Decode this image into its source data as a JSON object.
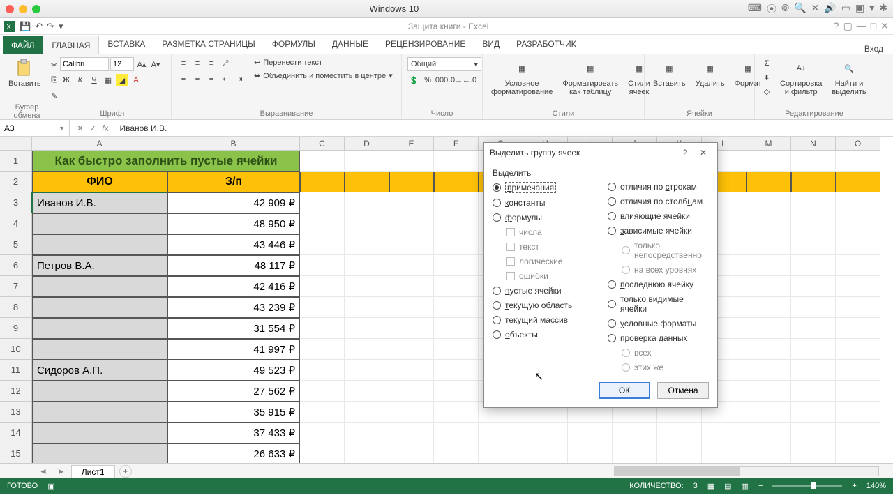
{
  "mac": {
    "title": "Windows 10"
  },
  "qat": {
    "title": "Защита книги - Excel",
    "help_hint": "?"
  },
  "tabs": {
    "file": "ФАЙЛ",
    "items": [
      "ГЛАВНАЯ",
      "ВСТАВКА",
      "РАЗМЕТКА СТРАНИЦЫ",
      "ФОРМУЛЫ",
      "ДАННЫЕ",
      "РЕЦЕНЗИРОВАНИЕ",
      "ВИД",
      "РАЗРАБОТЧИК"
    ],
    "active_index": 0,
    "sign_in": "Вход"
  },
  "ribbon": {
    "clipboard": {
      "paste": "Вставить",
      "label": "Буфер обмена"
    },
    "font": {
      "name": "Calibri",
      "size": "12",
      "label": "Шрифт",
      "b": "Ж",
      "i": "К",
      "u": "Ч"
    },
    "align": {
      "wrap": "Перенести текст",
      "merge": "Объединить и поместить в центре",
      "label": "Выравнивание"
    },
    "number": {
      "format": "Общий",
      "label": "Число"
    },
    "styles": {
      "cond": "Условное форматирование",
      "table": "Форматировать как таблицу",
      "cell": "Стили ячеек",
      "label": "Стили"
    },
    "cells": {
      "insert": "Вставить",
      "delete": "Удалить",
      "format": "Формат",
      "label": "Ячейки"
    },
    "editing": {
      "sort": "Сортировка и фильтр",
      "find": "Найти и выделить",
      "label": "Редактирование"
    }
  },
  "fx": {
    "namebox": "A3",
    "formula": "Иванов И.В."
  },
  "columns": [
    "A",
    "B",
    "C",
    "D",
    "E",
    "F",
    "G",
    "H",
    "I",
    "J",
    "K",
    "L",
    "M",
    "N",
    "O"
  ],
  "sheet": {
    "title_merged": "Как быстро заполнить пустые ячейки",
    "header": {
      "a": "ФИО",
      "b": "З/п"
    },
    "rows": [
      {
        "n": 3,
        "a": "Иванов И.В.",
        "b": "42 909 ₽"
      },
      {
        "n": 4,
        "a": "",
        "b": "48 950 ₽"
      },
      {
        "n": 5,
        "a": "",
        "b": "43 446 ₽"
      },
      {
        "n": 6,
        "a": "Петров В.А.",
        "b": "48 117 ₽"
      },
      {
        "n": 7,
        "a": "",
        "b": "42 416 ₽"
      },
      {
        "n": 8,
        "a": "",
        "b": "43 239 ₽"
      },
      {
        "n": 9,
        "a": "",
        "b": "31 554 ₽"
      },
      {
        "n": 10,
        "a": "",
        "b": "41 997 ₽"
      },
      {
        "n": 11,
        "a": "Сидоров А.П.",
        "b": "49 523 ₽"
      },
      {
        "n": 12,
        "a": "",
        "b": "27 562 ₽"
      },
      {
        "n": 13,
        "a": "",
        "b": "35 915 ₽"
      },
      {
        "n": 14,
        "a": "",
        "b": "37 433 ₽"
      },
      {
        "n": 15,
        "a": "",
        "b": "26 633 ₽"
      }
    ],
    "tab": "Лист1"
  },
  "dialog": {
    "title": "Выделить группу ячеек",
    "group_label": "Выделить",
    "options_left": [
      {
        "label": "примечания",
        "checked": true,
        "type": "radio",
        "access": "п"
      },
      {
        "label": "константы",
        "type": "radio",
        "access": "к"
      },
      {
        "label": "формулы",
        "type": "radio",
        "access": "ф"
      },
      {
        "label": "числа",
        "type": "check",
        "indent": true,
        "disabled": true
      },
      {
        "label": "текст",
        "type": "check",
        "indent": true,
        "disabled": true
      },
      {
        "label": "логические",
        "type": "check",
        "indent": true,
        "disabled": true
      },
      {
        "label": "ошибки",
        "type": "check",
        "indent": true,
        "disabled": true
      },
      {
        "label": "пустые ячейки",
        "type": "radio",
        "access": "п"
      },
      {
        "label": "текущую область",
        "type": "radio",
        "access": "т"
      },
      {
        "label": "текущий массив",
        "type": "radio",
        "access": "м"
      },
      {
        "label": "объекты",
        "type": "radio",
        "access": "о"
      }
    ],
    "options_right": [
      {
        "label": "отличия по строкам",
        "type": "radio",
        "access": "с"
      },
      {
        "label": "отличия по столбцам",
        "type": "radio",
        "access": "ц"
      },
      {
        "label": "влияющие ячейки",
        "type": "radio",
        "access": "в"
      },
      {
        "label": "зависимые ячейки",
        "type": "radio",
        "access": "з"
      },
      {
        "label": "только непосредственно",
        "type": "radio",
        "indent": true,
        "disabled": true
      },
      {
        "label": "на всех уровнях",
        "type": "radio",
        "indent": true,
        "disabled": true
      },
      {
        "label": "последнюю ячейку",
        "type": "radio",
        "access": "п"
      },
      {
        "label": "только видимые ячейки",
        "type": "radio",
        "access": "в"
      },
      {
        "label": "условные форматы",
        "type": "radio",
        "access": "у"
      },
      {
        "label": "проверка данных",
        "type": "radio",
        "access": "д"
      },
      {
        "label": "всех",
        "type": "radio",
        "indent": true,
        "disabled": true
      },
      {
        "label": "этих же",
        "type": "radio",
        "indent": true,
        "disabled": true
      }
    ],
    "ok": "ОК",
    "cancel": "Отмена"
  },
  "status": {
    "ready": "ГОТОВО",
    "count_lbl": "КОЛИЧЕСТВО:",
    "count": "3",
    "zoom": "140%"
  }
}
